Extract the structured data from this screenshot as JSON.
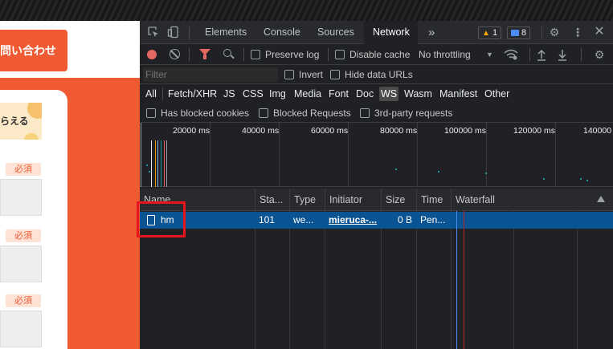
{
  "page": {
    "contact_button": "問い合わせ",
    "banner_text": "らえる",
    "required_label": "必須"
  },
  "devtools": {
    "tabs": [
      "Elements",
      "Console",
      "Sources",
      "Network"
    ],
    "active_tab": "Network",
    "more_tabs": "»",
    "warnings_count": "1",
    "messages_count": "8",
    "toolbar": {
      "preserve_log": "Preserve log",
      "disable_cache": "Disable cache",
      "throttling": "No throttling"
    },
    "filter": {
      "placeholder": "Filter",
      "invert": "Invert",
      "hide_data_urls": "Hide data URLs"
    },
    "types": [
      "All",
      "Fetch/XHR",
      "JS",
      "CSS",
      "Img",
      "Media",
      "Font",
      "Doc",
      "WS",
      "Wasm",
      "Manifest",
      "Other"
    ],
    "active_type": "WS",
    "options": {
      "has_blocked_cookies": "Has blocked cookies",
      "blocked_requests": "Blocked Requests",
      "third_party": "3rd-party requests"
    },
    "overview_ticks": [
      "20000 ms",
      "40000 ms",
      "60000 ms",
      "80000 ms",
      "100000 ms",
      "120000 ms",
      "140000"
    ],
    "columns": [
      "Name",
      "Sta...",
      "Type",
      "Initiator",
      "Size",
      "Time",
      "Waterfall"
    ],
    "rows": [
      {
        "name": "hm",
        "status": "101",
        "type": "we...",
        "initiator": "mieruca-...",
        "size": "0 B",
        "time": "Pen..."
      }
    ],
    "colors": {
      "selected_row": "#0b5493",
      "record": "#e46962",
      "highlight": "#e8161c"
    }
  }
}
